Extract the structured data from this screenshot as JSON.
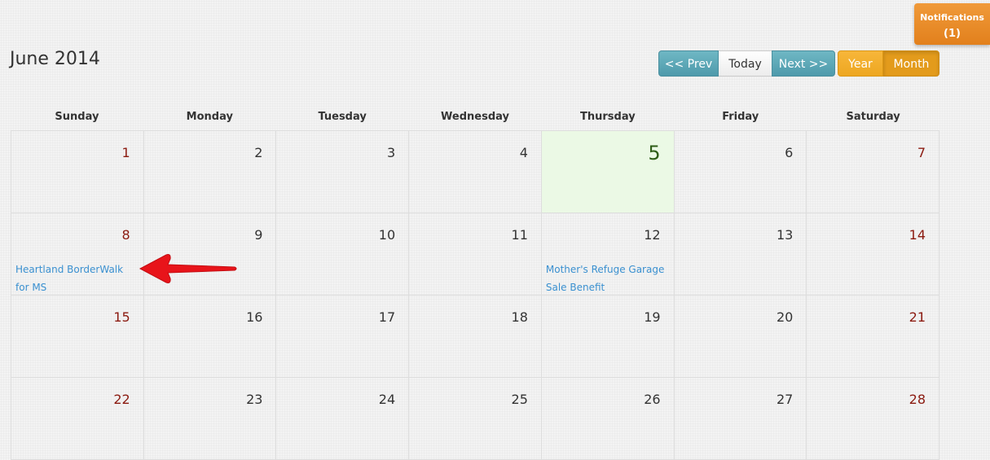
{
  "header": {
    "title": "June 2014"
  },
  "navigation": {
    "prev_label": "<< Prev",
    "today_label": "Today",
    "next_label": "Next >>"
  },
  "view": {
    "year_label": "Year",
    "month_label": "Month",
    "active": "Month"
  },
  "notifications": {
    "label": "Notifications",
    "count": "(1)"
  },
  "calendar": {
    "weekdays": [
      "Sunday",
      "Monday",
      "Tuesday",
      "Wednesday",
      "Thursday",
      "Friday",
      "Saturday"
    ],
    "today": "5",
    "weeks": [
      [
        {
          "day": "1"
        },
        {
          "day": "2"
        },
        {
          "day": "3"
        },
        {
          "day": "4"
        },
        {
          "day": "5"
        },
        {
          "day": "6"
        },
        {
          "day": "7"
        }
      ],
      [
        {
          "day": "8",
          "event": "Heartland BorderWalk for MS"
        },
        {
          "day": "9"
        },
        {
          "day": "10"
        },
        {
          "day": "11"
        },
        {
          "day": "12",
          "event": "Mother's Refuge Garage Sale Benefit"
        },
        {
          "day": "13"
        },
        {
          "day": "14"
        }
      ],
      [
        {
          "day": "15"
        },
        {
          "day": "16"
        },
        {
          "day": "17"
        },
        {
          "day": "18"
        },
        {
          "day": "19"
        },
        {
          "day": "20"
        },
        {
          "day": "21"
        }
      ],
      [
        {
          "day": "22"
        },
        {
          "day": "23"
        },
        {
          "day": "24"
        },
        {
          "day": "25"
        },
        {
          "day": "26"
        },
        {
          "day": "27"
        },
        {
          "day": "28"
        }
      ]
    ]
  },
  "annotation": {
    "arrow_color": "#e8141a",
    "points_to": "Heartland BorderWalk for MS"
  }
}
